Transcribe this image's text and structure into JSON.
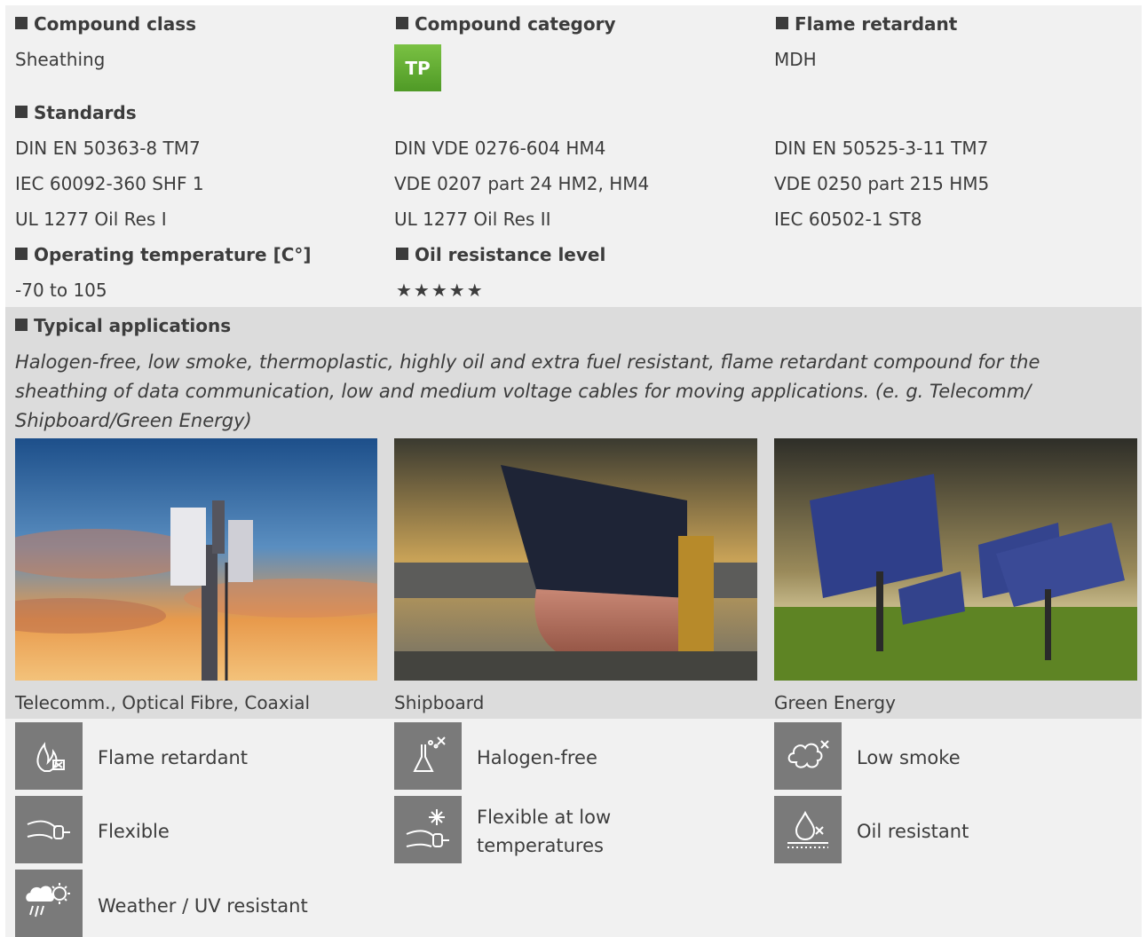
{
  "compound_class": {
    "label": "Compound class",
    "value": "Sheathing"
  },
  "compound_category": {
    "label": "Compound category",
    "badge": "TP",
    "badge_color": "#5aab2e"
  },
  "flame_retardant": {
    "label": "Flame retardant",
    "value": "MDH"
  },
  "standards": {
    "label": "Standards",
    "items": [
      "DIN EN 50363-8 TM7",
      "DIN VDE 0276-604 HM4",
      "DIN EN 50525-3-11 TM7",
      "IEC 60092-360 SHF 1",
      "VDE 0207 part 24 HM2, HM4",
      "VDE 0250 part 215 HM5",
      "UL 1277 Oil Res I",
      "UL 1277 Oil Res II",
      "IEC 60502-1 ST8"
    ]
  },
  "operating_temperature": {
    "label": "Operating temperature [C°]",
    "value": "-70 to 105"
  },
  "oil_resistance": {
    "label": "Oil resistance level",
    "stars": "★★★★★",
    "rating": 5,
    "max": 5
  },
  "applications": {
    "label": "Typical applications",
    "description": "Halogen-free, low smoke, thermoplastic, highly oil and extra fuel resistant, flame retardant compound for the sheathing of data communication, low and medium voltage cables for moving applications. (e. g. Telecomm/ Shipboard/Green Energy)",
    "images": [
      {
        "caption": "Telecomm., Optical Fibre, Coaxial",
        "icon": "telecom-tower-photo"
      },
      {
        "caption": "Shipboard",
        "icon": "ship-photo"
      },
      {
        "caption": "Green Energy",
        "icon": "solar-panel-photo"
      }
    ]
  },
  "features": [
    {
      "label": "Flame retardant",
      "icon": "flame-icon"
    },
    {
      "label": "Halogen-free",
      "icon": "flask-icon"
    },
    {
      "label": "Low smoke",
      "icon": "smoke-cloud-icon"
    },
    {
      "label": "Flexible",
      "icon": "flexible-cable-icon"
    },
    {
      "label": "Flexible at low temperatures",
      "icon": "snowflake-cable-icon"
    },
    {
      "label": "Oil resistant",
      "icon": "oil-drop-icon"
    },
    {
      "label": "Weather / UV resistant",
      "icon": "weather-uv-icon"
    }
  ],
  "colors": {
    "panel_light": "#f1f1f1",
    "panel_dark": "#dcdcdc",
    "icon_bg": "#7a7a7a",
    "text": "#3c3c3c"
  }
}
